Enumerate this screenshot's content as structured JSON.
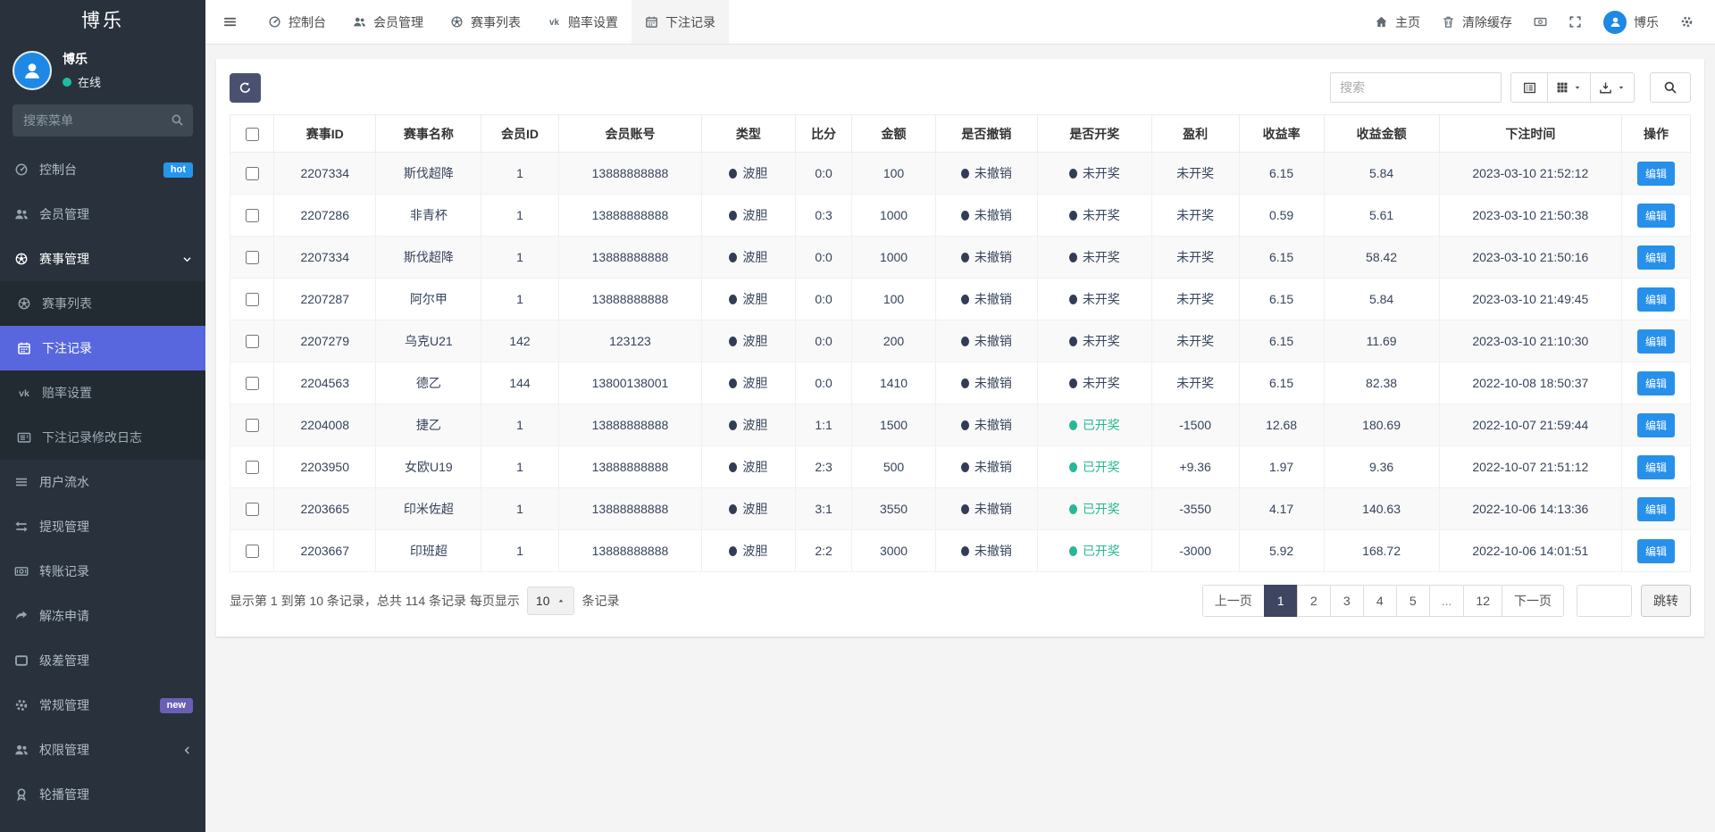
{
  "app": {
    "brand": "博乐"
  },
  "colors": {
    "accent": "#5867dd",
    "edit_button": "#2790ea",
    "success": "#26b894",
    "dark_dot": "#323d55",
    "active_page": "#3d4560",
    "online": "#1dbf9e",
    "avatar": "#1e88e5",
    "badge_hot": "#2596ee",
    "badge_new": "#6a5fb5"
  },
  "sidebar": {
    "user": {
      "name": "博乐",
      "status": "在线"
    },
    "search_placeholder": "搜索菜单",
    "items": [
      {
        "name": "console",
        "label": "控制台",
        "icon": "dashboard",
        "badge": "hot",
        "badge_color": "#2596ee"
      },
      {
        "name": "members",
        "label": "会员管理",
        "icon": "users"
      },
      {
        "name": "matches",
        "label": "赛事管理",
        "icon": "futbol",
        "chevron": "down",
        "open": true
      },
      {
        "name": "match-list",
        "label": "赛事列表",
        "icon": "futbol",
        "sub": true
      },
      {
        "name": "bet-records",
        "label": "下注记录",
        "icon": "calendar",
        "sub": true,
        "active": true
      },
      {
        "name": "odds-settings",
        "label": "赔率设置",
        "icon": "vk",
        "sub": true
      },
      {
        "name": "bet-record-logs",
        "label": "下注记录修改日志",
        "icon": "newspaper",
        "sub": true
      },
      {
        "name": "user-flows",
        "label": "用户流水",
        "icon": "list"
      },
      {
        "name": "withdrawals",
        "label": "提现管理",
        "icon": "exchange"
      },
      {
        "name": "transfers",
        "label": "转账记录",
        "icon": "money"
      },
      {
        "name": "unfreeze-requests",
        "label": "解冻申请",
        "icon": "share"
      },
      {
        "name": "level-diff",
        "label": "级差管理",
        "icon": "window"
      },
      {
        "name": "general",
        "label": "常规管理",
        "icon": "cogs",
        "badge": "new",
        "badge_color": "#6a5fb5"
      },
      {
        "name": "permissions",
        "label": "权限管理",
        "icon": "users",
        "chevron": "left"
      },
      {
        "name": "carousel",
        "label": "轮播管理",
        "icon": "award"
      }
    ]
  },
  "navbar": {
    "left": [
      {
        "name": "console",
        "label": "控制台",
        "icon": "dashboard"
      },
      {
        "name": "members",
        "label": "会员管理",
        "icon": "users"
      },
      {
        "name": "match-list",
        "label": "赛事列表",
        "icon": "futbol"
      },
      {
        "name": "odds-settings",
        "label": "赔率设置",
        "icon": "vk"
      },
      {
        "name": "bet-records",
        "label": "下注记录",
        "icon": "calendar",
        "active": true
      }
    ],
    "right": [
      {
        "name": "home",
        "label": "主页",
        "icon": "home"
      },
      {
        "name": "clear-cache",
        "label": "清除缓存",
        "icon": "trash"
      },
      {
        "name": "bill",
        "icon": "bill"
      },
      {
        "name": "fullscreen",
        "icon": "expand"
      },
      {
        "name": "profile",
        "label": "博乐",
        "icon": "avatar"
      },
      {
        "name": "settings",
        "icon": "cogs"
      }
    ]
  },
  "toolbar": {
    "search_placeholder": "搜索"
  },
  "table": {
    "edit_label": "编辑",
    "columns": [
      "",
      "赛事ID",
      "赛事名称",
      "会员ID",
      "会员账号",
      "类型",
      "比分",
      "金额",
      "是否撤销",
      "是否开奖",
      "盈利",
      "收益率",
      "收益金额",
      "下注时间",
      "操作"
    ],
    "rows": [
      {
        "match_id": "2207334",
        "match_name": "斯伐超降",
        "member_id": "1",
        "account": "13888888888",
        "type": "波胆",
        "score": "0:0",
        "amount": "100",
        "revoked": "未撤销",
        "drawn": "未开奖",
        "drawn_done": false,
        "profit": "未开奖",
        "rate": "6.15",
        "yield": "5.84",
        "time": "2023-03-10 21:52:12"
      },
      {
        "match_id": "2207286",
        "match_name": "非青杯",
        "member_id": "1",
        "account": "13888888888",
        "type": "波胆",
        "score": "0:3",
        "amount": "1000",
        "revoked": "未撤销",
        "drawn": "未开奖",
        "drawn_done": false,
        "profit": "未开奖",
        "rate": "0.59",
        "yield": "5.61",
        "time": "2023-03-10 21:50:38"
      },
      {
        "match_id": "2207334",
        "match_name": "斯伐超降",
        "member_id": "1",
        "account": "13888888888",
        "type": "波胆",
        "score": "0:0",
        "amount": "1000",
        "revoked": "未撤销",
        "drawn": "未开奖",
        "drawn_done": false,
        "profit": "未开奖",
        "rate": "6.15",
        "yield": "58.42",
        "time": "2023-03-10 21:50:16"
      },
      {
        "match_id": "2207287",
        "match_name": "阿尔甲",
        "member_id": "1",
        "account": "13888888888",
        "type": "波胆",
        "score": "0:0",
        "amount": "100",
        "revoked": "未撤销",
        "drawn": "未开奖",
        "drawn_done": false,
        "profit": "未开奖",
        "rate": "6.15",
        "yield": "5.84",
        "time": "2023-03-10 21:49:45"
      },
      {
        "match_id": "2207279",
        "match_name": "乌克U21",
        "member_id": "142",
        "account": "123123",
        "type": "波胆",
        "score": "0:0",
        "amount": "200",
        "revoked": "未撤销",
        "drawn": "未开奖",
        "drawn_done": false,
        "profit": "未开奖",
        "rate": "6.15",
        "yield": "11.69",
        "time": "2023-03-10 21:10:30"
      },
      {
        "match_id": "2204563",
        "match_name": "德乙",
        "member_id": "144",
        "account": "13800138001",
        "type": "波胆",
        "score": "0:0",
        "amount": "1410",
        "revoked": "未撤销",
        "drawn": "未开奖",
        "drawn_done": false,
        "profit": "未开奖",
        "rate": "6.15",
        "yield": "82.38",
        "time": "2022-10-08 18:50:37"
      },
      {
        "match_id": "2204008",
        "match_name": "捷乙",
        "member_id": "1",
        "account": "13888888888",
        "type": "波胆",
        "score": "1:1",
        "amount": "1500",
        "revoked": "未撤销",
        "drawn": "已开奖",
        "drawn_done": true,
        "profit": "-1500",
        "rate": "12.68",
        "yield": "180.69",
        "time": "2022-10-07 21:59:44"
      },
      {
        "match_id": "2203950",
        "match_name": "女欧U19",
        "member_id": "1",
        "account": "13888888888",
        "type": "波胆",
        "score": "2:3",
        "amount": "500",
        "revoked": "未撤销",
        "drawn": "已开奖",
        "drawn_done": true,
        "profit": "+9.36",
        "rate": "1.97",
        "yield": "9.36",
        "time": "2022-10-07 21:51:12"
      },
      {
        "match_id": "2203665",
        "match_name": "印米佐超",
        "member_id": "1",
        "account": "13888888888",
        "type": "波胆",
        "score": "3:1",
        "amount": "3550",
        "revoked": "未撤销",
        "drawn": "已开奖",
        "drawn_done": true,
        "profit": "-3550",
        "rate": "4.17",
        "yield": "140.63",
        "time": "2022-10-06 14:13:36"
      },
      {
        "match_id": "2203667",
        "match_name": "印班超",
        "member_id": "1",
        "account": "13888888888",
        "type": "波胆",
        "score": "2:2",
        "amount": "3000",
        "revoked": "未撤销",
        "drawn": "已开奖",
        "drawn_done": true,
        "profit": "-3000",
        "rate": "5.92",
        "yield": "168.72",
        "time": "2022-10-06 14:01:51"
      }
    ]
  },
  "footer": {
    "summary_prefix": "显示第 1 到第 10 条记录，总共 114 条记录 每页显示",
    "page_size": "10",
    "summary_suffix": "条记录",
    "pagination": {
      "prev": "上一页",
      "pages": [
        "1",
        "2",
        "3",
        "4",
        "5",
        "...",
        "12"
      ],
      "active": "1",
      "next": "下一页",
      "jump_label": "跳转"
    }
  }
}
